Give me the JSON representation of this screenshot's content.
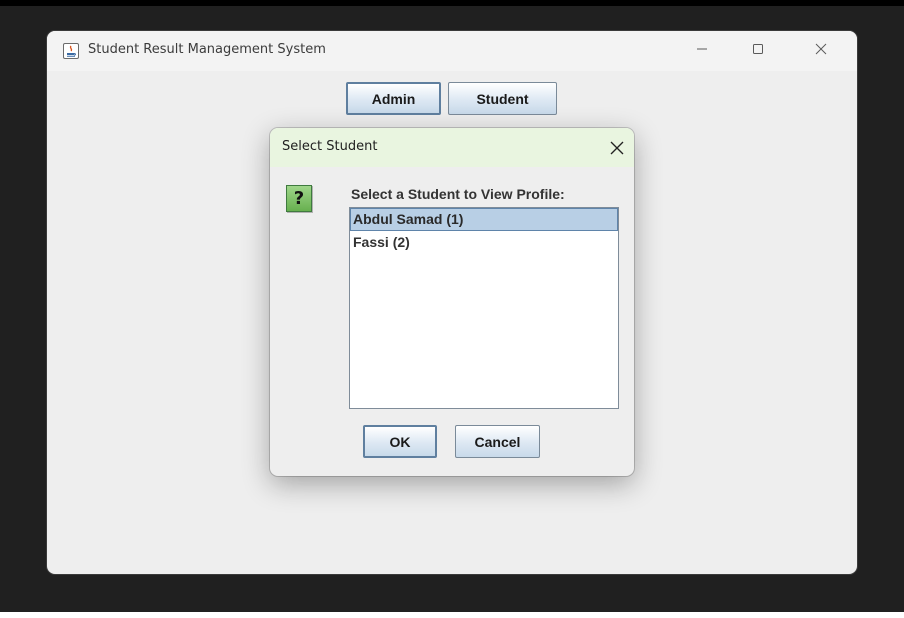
{
  "main_window": {
    "title": "Student Result Management System",
    "buttons": {
      "admin": "Admin",
      "student": "Student"
    }
  },
  "dialog": {
    "title": "Select Student",
    "icon": "question-icon",
    "icon_glyph": "?",
    "message": "Select a Student to View Profile:",
    "students": [
      {
        "label": "Abdul Samad (1)",
        "selected": true
      },
      {
        "label": "Fassi (2)",
        "selected": false
      }
    ],
    "ok_label": "OK",
    "cancel_label": "Cancel"
  },
  "colors": {
    "dialog_title_bg": "#e9f5e0",
    "selection_bg": "#b8cfe5",
    "window_bg": "#eeeeee",
    "desktop_bg": "#202020"
  }
}
